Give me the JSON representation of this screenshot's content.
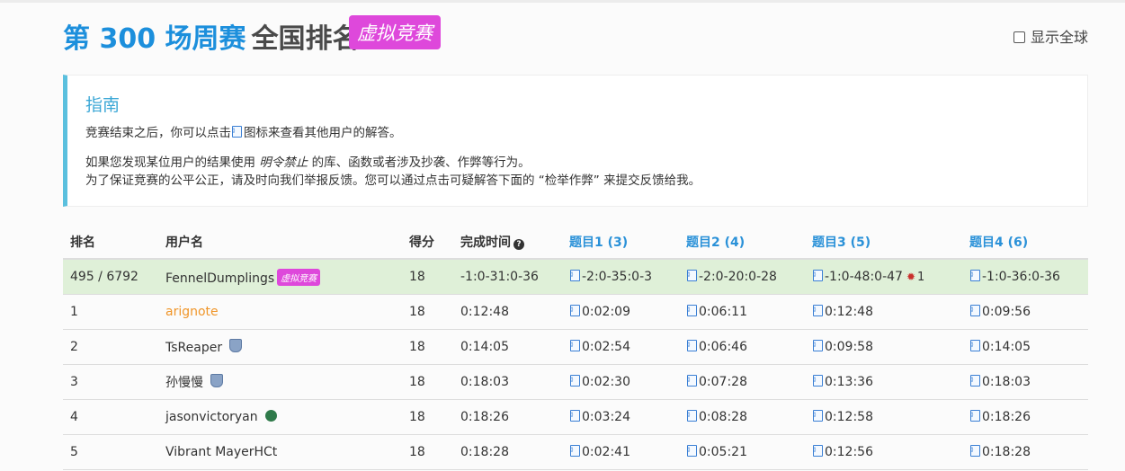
{
  "header": {
    "contest_title": "第 300 场周赛",
    "rank_title": "全国排名",
    "virtual_badge": "虚拟竞赛",
    "global_toggle_label": "显示全球"
  },
  "guide": {
    "title": "指南",
    "p1_before": "竞赛结束之后，你可以点击",
    "p1_after": "图标来查看其他用户的解答。",
    "p2_before": "如果您发现某位用户的结果使用 ",
    "p2_em": "明令禁止",
    "p2_after": " 的库、函数或者涉及抄袭、作弊等行为。",
    "p3": "为了保证竞赛的公平公正，请及时向我们举报反馈。您可以通过点击可疑解答下面的 “检举作弊” 来提交反馈给我。"
  },
  "table": {
    "headers": {
      "rank": "排名",
      "username": "用户名",
      "score": "得分",
      "finish_time": "完成时间",
      "q1": "题目1 (3)",
      "q2": "题目2 (4)",
      "q3": "题目3 (5)",
      "q4": "题目4 (6)"
    },
    "my_row": {
      "rank": "495 / 6792",
      "username": "FennelDumplings",
      "badge": "虚拟竞赛",
      "score": "18",
      "finish_time": "-1:0-31:0-36",
      "q1": "-2:0-35:0-3",
      "q2": "-2:0-20:0-28",
      "q3": "-1:0-48:0-47",
      "q3_bugs": "1",
      "q4": "-1:0-36:0-36"
    },
    "rows": [
      {
        "rank": "1",
        "username": "arignote",
        "score": "18",
        "finish_time": "0:12:48",
        "q1": "0:02:09",
        "q2": "0:06:11",
        "q3": "0:12:48",
        "q4": "0:09:56"
      },
      {
        "rank": "2",
        "username": "TsReaper",
        "score": "18",
        "finish_time": "0:14:05",
        "q1": "0:02:54",
        "q2": "0:06:46",
        "q3": "0:09:58",
        "q4": "0:14:05"
      },
      {
        "rank": "3",
        "username": "孙慢慢",
        "score": "18",
        "finish_time": "0:18:03",
        "q1": "0:02:30",
        "q2": "0:07:28",
        "q3": "0:13:36",
        "q4": "0:18:03"
      },
      {
        "rank": "4",
        "username": "jasonvictoryan",
        "score": "18",
        "finish_time": "0:18:26",
        "q1": "0:03:24",
        "q2": "0:08:28",
        "q3": "0:12:58",
        "q4": "0:18:26"
      },
      {
        "rank": "5",
        "username": "Vibrant MayerHCt",
        "score": "18",
        "finish_time": "0:18:28",
        "q1": "0:02:41",
        "q2": "0:05:21",
        "q3": "0:12:56",
        "q4": "0:18:28"
      }
    ]
  },
  "colors": {
    "accent_blue": "#1c8fdc",
    "virtual_pink": "#de48db",
    "highlight_row": "#dff0d8",
    "guide_border": "#5bc0de"
  }
}
